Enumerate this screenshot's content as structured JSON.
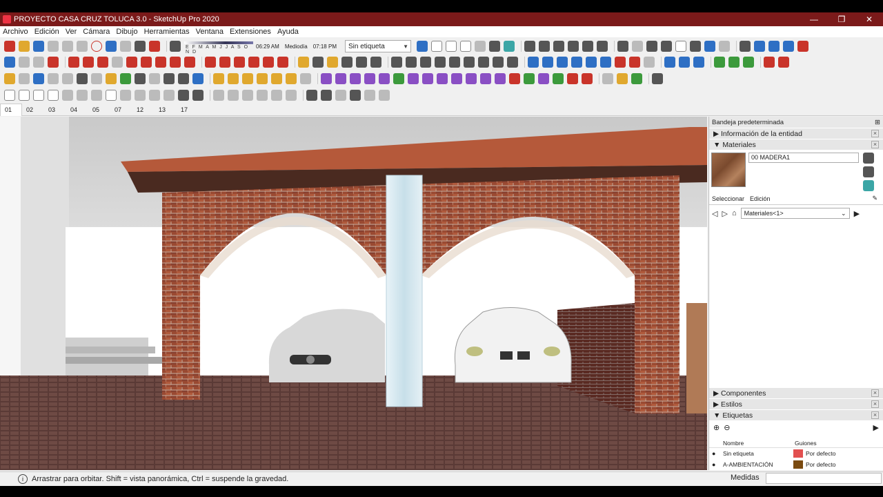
{
  "window": {
    "title": "PROYECTO CASA CRUZ TOLUCA 3.0 - SketchUp Pro 2020",
    "controls": [
      "—",
      "❐",
      "✕"
    ]
  },
  "menu": [
    "Archivo",
    "Edición",
    "Ver",
    "Cámara",
    "Dibujo",
    "Herramientas",
    "Ventana",
    "Extensiones",
    "Ayuda"
  ],
  "shadows": {
    "months": "E F M A M J J A S O N D",
    "time_start": "06:29 AM",
    "time_mid": "Mediodía",
    "time_end": "07:18 PM"
  },
  "tag_select": "Sin etiqueta",
  "scenes": [
    "01",
    "02",
    "03",
    "04",
    "05",
    "07",
    "12",
    "13",
    "17"
  ],
  "tray": {
    "title": "Bandeja predeterminada",
    "sections": {
      "entity_info": "Información de la entidad",
      "materials": "Materiales",
      "components": "Componentes",
      "styles": "Estilos",
      "tags": "Etiquetas"
    },
    "material_name": "00 MADERA1",
    "mat_tabs": [
      "Seleccionar",
      "Edición"
    ],
    "mat_collection": "Materiales<1>",
    "tags_columns": [
      "Nombre",
      "Guiones"
    ],
    "tags_rows": [
      {
        "name": "Sin etiqueta",
        "dash": "Por defecto",
        "color": "#e25050"
      },
      {
        "name": "A-AMBIENTACIÓN",
        "dash": "Por defecto",
        "color": "#7a4a10"
      }
    ]
  },
  "status": {
    "hint": "Arrastrar para orbitar. Shift = vista panorámica, Ctrl = suspende la gravedad.",
    "measure_label": "Medidas"
  },
  "colors": {
    "title_bar": "#7b1a1a",
    "brick": "#9a4a32",
    "roof_tile": "#b5593a"
  }
}
